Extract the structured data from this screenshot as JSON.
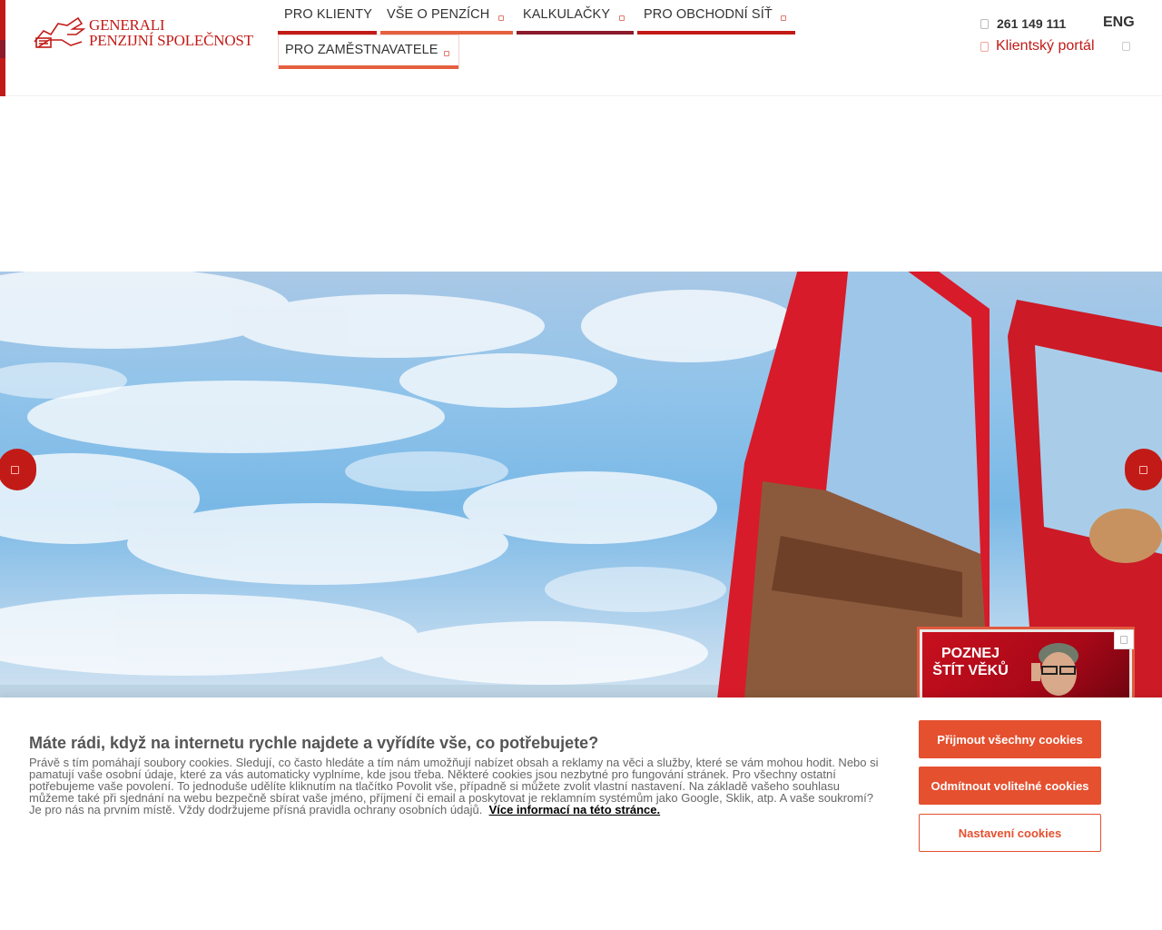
{
  "header": {
    "logo_line1": "GENERALI",
    "logo_line2": "PENZIJNÍ SPOLEČNOST",
    "nav": [
      {
        "label": "PRO KLIENTY",
        "has_dropdown": false,
        "bar_color": "#c21b17"
      },
      {
        "label": "VŠE O PENZÍCH",
        "has_dropdown": true,
        "bar_color": "#e5603f"
      },
      {
        "label": "KALKULAČKY",
        "has_dropdown": true,
        "bar_color": "#8b1a2b"
      },
      {
        "label": "PRO OBCHODNÍ SÍŤ",
        "has_dropdown": true,
        "bar_color": "#c21b17"
      },
      {
        "label": "PRO ZAMĚSTNAVATELE",
        "has_dropdown": true,
        "bar_color": "#e5603f"
      }
    ],
    "phone": "261 149 111",
    "portal": "Klientský portál",
    "lang": "ENG"
  },
  "promo": {
    "title": "POZNEJ ŠTÍT VĚKŮ"
  },
  "cookie": {
    "title": "Máte rádi, když na internetu rychle najdete a vyřídíte vše, co potřebujete?",
    "text": "Právě s tím pomáhají soubory cookies. Sledují, co často hledáte a tím nám umožňují nabízet obsah a reklamy na věci a služby, které se vám mohou hodit. Nebo si pamatují vaše osobní údaje, které za vás automaticky vyplníme, kde jsou třeba. Některé cookies jsou nezbytné pro fungování stránek. Pro všechny ostatní potřebujeme vaše povolení. To jednoduše udělíte kliknutím na tlačítko Povolit vše, případně si můžete zvolit vlastní nastavení. Na základě vašeho souhlasu můžeme také při sjednání na webu bezpečně sbírat vaše jméno, příjmení či email a poskytovat je reklamním systémům jako Google, Sklik, atp. A vaše soukromí? Je pro nás na prvním místě. Vždy dodržujeme přísná pravidla ochrany osobních údajů.",
    "more_link": "Více informací na této stránce.",
    "accept_all": "Přijmout všechny cookies",
    "reject": "Odmítnout volitelné cookies",
    "settings": "Nastavení cookies"
  },
  "colors": {
    "brand_red": "#c21b17",
    "accent_orange": "#e5502f",
    "burgundy": "#8b1a2b"
  }
}
